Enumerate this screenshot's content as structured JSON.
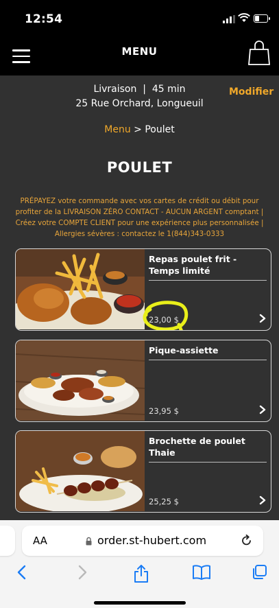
{
  "status_bar": {
    "time": "12:54"
  },
  "header": {
    "title": "MENU"
  },
  "delivery": {
    "mode_line": "Livraison  |  45 min",
    "address": "25 Rue Orchard, Longueuil",
    "modify_label": "Modifier"
  },
  "breadcrumb": {
    "parent": "Menu",
    "separator": " > ",
    "current": "Poulet"
  },
  "page_title": "POULET",
  "notice": "PRÉPAYEZ votre commande avec vos cartes de crédit ou débit pour profiter de la LIVRAISON ZÉRO CONTACT - AUCUN ARGENT comptant | Créez votre COMPTE CLIENT pour une expérience plus personnalisée | Allergies sévères : contactez le 1(844)343-0333",
  "items": [
    {
      "name": "Repas poulet frit - Temps limité",
      "price": "23,00 $"
    },
    {
      "name": "Pique-assiette",
      "price": "23,95 $"
    },
    {
      "name": "Brochette de poulet Thaie",
      "price": "25,25 $"
    }
  ],
  "browser": {
    "aa_label": "AA",
    "url": "order.st-hubert.com"
  },
  "colors": {
    "accent": "#f0a82a",
    "background": "#313131",
    "highlight": "#e9ef1a",
    "ios_blue": "#1a7cf5"
  }
}
